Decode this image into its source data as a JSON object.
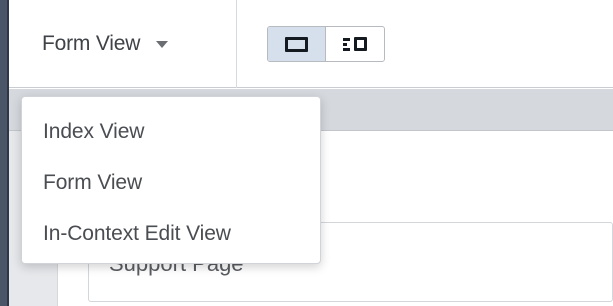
{
  "toolbar": {
    "view_selector": {
      "selected": "Form View"
    },
    "layout_toggle": {
      "options": [
        {
          "icon": "single-panel-icon",
          "active": true
        },
        {
          "icon": "split-panel-icon",
          "active": false
        }
      ]
    }
  },
  "dropdown": {
    "items": [
      "Index View",
      "Form View",
      "In-Context Edit View"
    ]
  },
  "content": {
    "field_text": "Support Page"
  },
  "colors": {
    "active_toggle_bg": "#d6e0ec",
    "text": "#3f4247",
    "content_bg": "#e6e8eb"
  }
}
